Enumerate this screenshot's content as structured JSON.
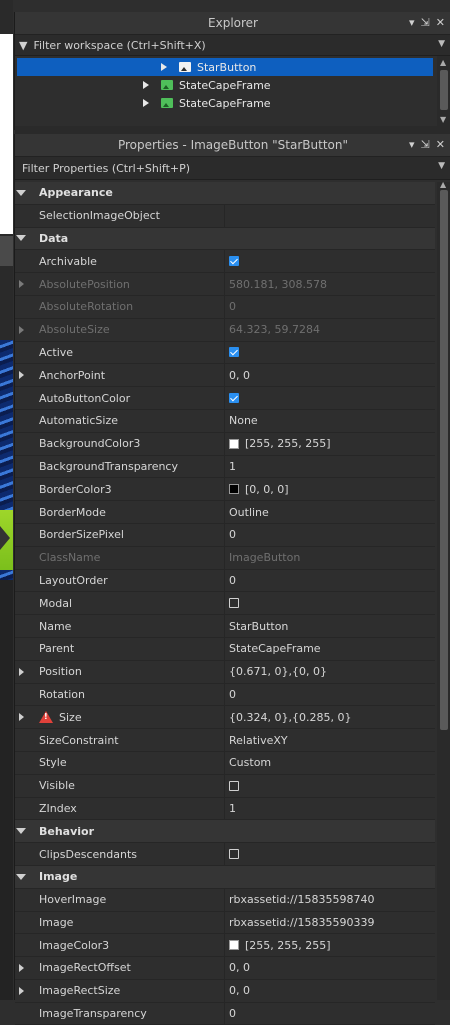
{
  "explorer": {
    "title": "Explorer",
    "filter_placeholder": "Filter workspace (Ctrl+Shift+X)",
    "items": [
      {
        "label": "StarButton",
        "icon": "image-button-icon",
        "selected": true
      },
      {
        "label": "StateCapeFrame",
        "icon": "image-frame-icon",
        "selected": false
      },
      {
        "label": "StateCapeFrame",
        "icon": "image-frame-icon",
        "selected": false
      }
    ]
  },
  "properties": {
    "title": "Properties - ImageButton \"StarButton\"",
    "filter_placeholder": "Filter Properties (Ctrl+Shift+P)",
    "rows": [
      {
        "type": "cat",
        "name": "Appearance"
      },
      {
        "type": "prop",
        "name": "SelectionImageObject",
        "value": ""
      },
      {
        "type": "cat",
        "name": "Data"
      },
      {
        "type": "prop",
        "name": "Archivable",
        "check": true
      },
      {
        "type": "prop",
        "name": "AbsolutePosition",
        "value": "580.181, 308.578",
        "expand": true,
        "readonly": true
      },
      {
        "type": "prop",
        "name": "AbsoluteRotation",
        "value": "0",
        "readonly": true
      },
      {
        "type": "prop",
        "name": "AbsoluteSize",
        "value": "64.323, 59.7284",
        "expand": true,
        "readonly": true
      },
      {
        "type": "prop",
        "name": "Active",
        "check": true
      },
      {
        "type": "prop",
        "name": "AnchorPoint",
        "value": "0, 0",
        "expand": true
      },
      {
        "type": "prop",
        "name": "AutoButtonColor",
        "check": true
      },
      {
        "type": "prop",
        "name": "AutomaticSize",
        "value": "None"
      },
      {
        "type": "prop",
        "name": "BackgroundColor3",
        "value": "[255, 255, 255]",
        "swatch": "#ffffff"
      },
      {
        "type": "prop",
        "name": "BackgroundTransparency",
        "value": "1"
      },
      {
        "type": "prop",
        "name": "BorderColor3",
        "value": "[0, 0, 0]",
        "swatch": "#000000"
      },
      {
        "type": "prop",
        "name": "BorderMode",
        "value": "Outline"
      },
      {
        "type": "prop",
        "name": "BorderSizePixel",
        "value": "0"
      },
      {
        "type": "prop",
        "name": "ClassName",
        "value": "ImageButton",
        "readonly": true
      },
      {
        "type": "prop",
        "name": "LayoutOrder",
        "value": "0"
      },
      {
        "type": "prop",
        "name": "Modal",
        "check": false
      },
      {
        "type": "prop",
        "name": "Name",
        "value": "StarButton"
      },
      {
        "type": "prop",
        "name": "Parent",
        "value": "StateCapeFrame"
      },
      {
        "type": "prop",
        "name": "Position",
        "value": "{0.671, 0},{0, 0}",
        "expand": true
      },
      {
        "type": "prop",
        "name": "Rotation",
        "value": "0"
      },
      {
        "type": "prop",
        "name": "Size",
        "value": "{0.324, 0},{0.285, 0}",
        "expand": true,
        "warning": true
      },
      {
        "type": "prop",
        "name": "SizeConstraint",
        "value": "RelativeXY"
      },
      {
        "type": "prop",
        "name": "Style",
        "value": "Custom"
      },
      {
        "type": "prop",
        "name": "Visible",
        "check": false
      },
      {
        "type": "prop",
        "name": "ZIndex",
        "value": "1"
      },
      {
        "type": "cat",
        "name": "Behavior"
      },
      {
        "type": "prop",
        "name": "ClipsDescendants",
        "check": false
      },
      {
        "type": "cat",
        "name": "Image"
      },
      {
        "type": "prop",
        "name": "HoverImage",
        "value": "rbxassetid://15835598740"
      },
      {
        "type": "prop",
        "name": "Image",
        "value": "rbxassetid://15835590339"
      },
      {
        "type": "prop",
        "name": "ImageColor3",
        "value": "[255, 255, 255]",
        "swatch": "#ffffff"
      },
      {
        "type": "prop",
        "name": "ImageRectOffset",
        "value": "0, 0",
        "expand": true
      },
      {
        "type": "prop",
        "name": "ImageRectSize",
        "value": "0, 0",
        "expand": true
      },
      {
        "type": "prop",
        "name": "ImageTransparency",
        "value": "0"
      }
    ]
  },
  "colors": {
    "selection": "#0e5fbf",
    "checkbox": "#2a8ff0",
    "warning": "#e0413a"
  }
}
